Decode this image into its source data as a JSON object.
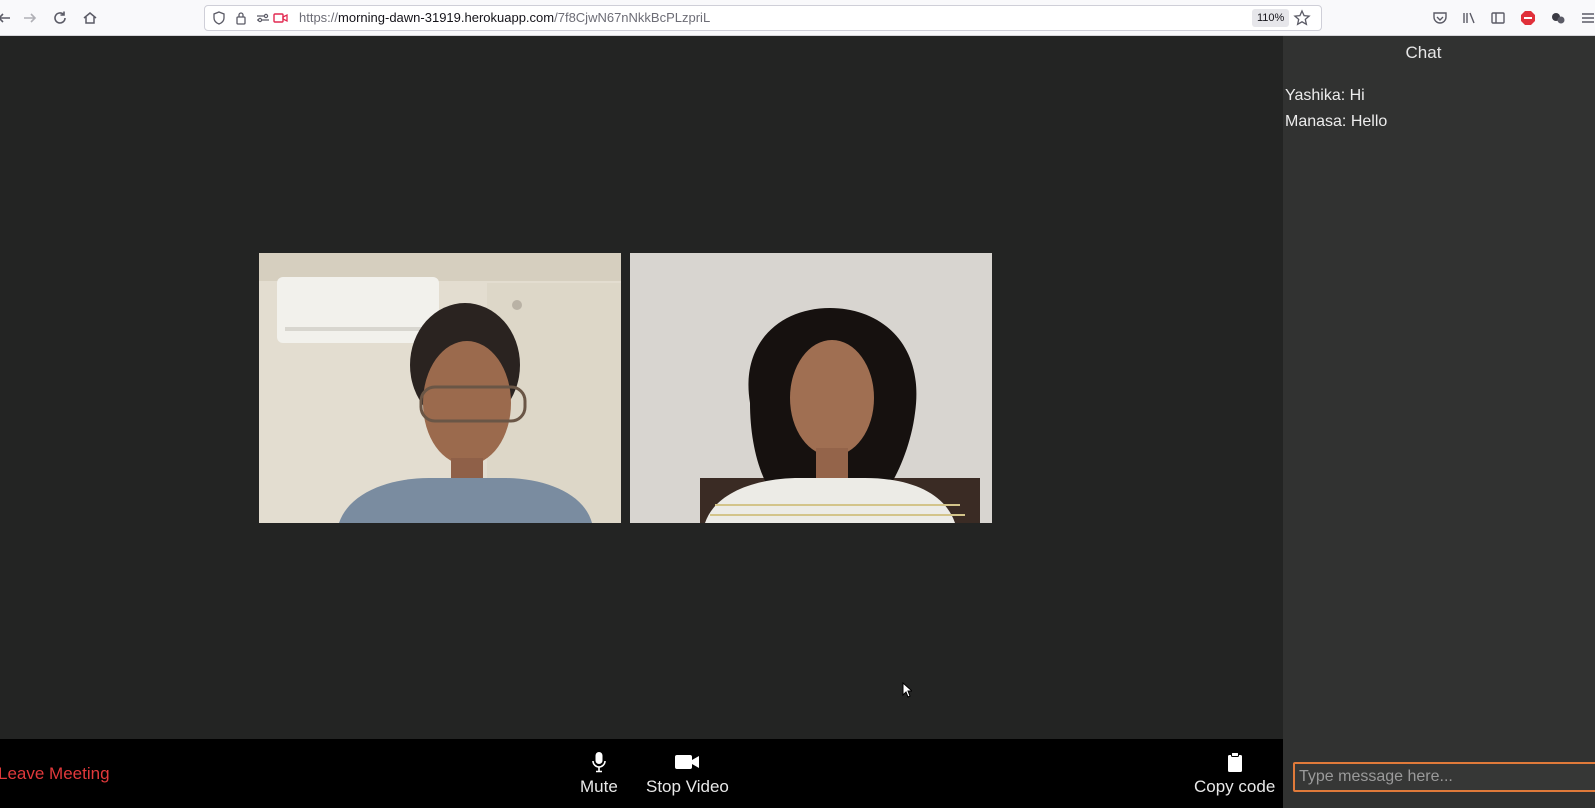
{
  "browser": {
    "url_scheme": "https://",
    "url_host": "morning-dawn-31919.herokuapp.com",
    "url_path": "/7f8CjwN67nNkkBcPLzpriL",
    "zoom": "110%",
    "icons": [
      "back-arrow-icon",
      "forward-arrow-icon",
      "reload-icon",
      "home-icon",
      "shield-icon",
      "lock-icon",
      "permissions-icon",
      "camera-sharing-icon",
      "bookmark-star-icon",
      "pocket-icon",
      "library-icon",
      "sidebar-icon",
      "adblock-icon",
      "extensions-icon",
      "menu-icon"
    ]
  },
  "videos": [
    {
      "id": "participant-1"
    },
    {
      "id": "participant-2"
    }
  ],
  "controls": {
    "leave_label": "Leave Meeting",
    "mute_label": "Mute",
    "stop_video_label": "Stop Video",
    "copy_code_label": "Copy code"
  },
  "chat": {
    "title": "Chat",
    "messages": [
      {
        "text": "Yashika: Hi"
      },
      {
        "text": "Manasa: Hello"
      }
    ],
    "input_placeholder": "Type message here...",
    "input_value": ""
  },
  "colors": {
    "stage_bg": "#232423",
    "controls_bg": "#000000",
    "chat_bg": "#313231",
    "leave_text": "#e1393b",
    "input_border": "#e07a3a"
  }
}
